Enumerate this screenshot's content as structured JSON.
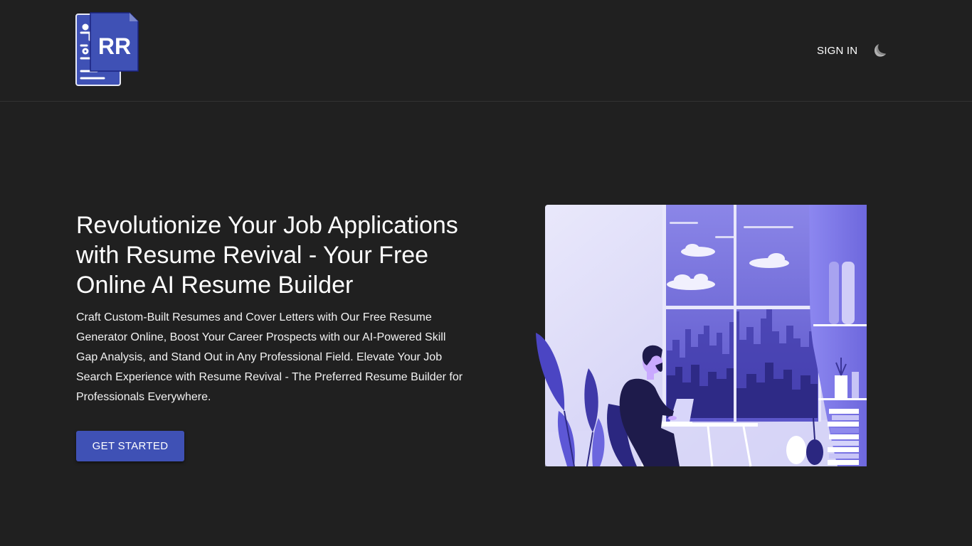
{
  "header": {
    "logo_text": "RR",
    "signin_label": "SIGN IN",
    "theme_toggle_icon": "moon-icon"
  },
  "hero": {
    "title": "Revolutionize Your Job Applications with Resume Revival - Your Free Online AI Resume Builder",
    "description": "Craft Custom-Built Resumes and Cover Letters with Our Free Resume Generator Online, Boost Your Career Prospects with our AI-Powered Skill Gap Analysis, and Stand Out in Any Professional Field. Elevate Your Job Search Experience with Resume Revival - The Preferred Resume Builder for Professionals Everywhere.",
    "cta_label": "GET STARTED",
    "illustration": "man-working-on-laptop-by-window-illustration"
  },
  "colors": {
    "background": "#202020",
    "accent": "#3f51b5",
    "illustration_primary": "#7b74e6",
    "illustration_dark": "#1e1b4b"
  }
}
